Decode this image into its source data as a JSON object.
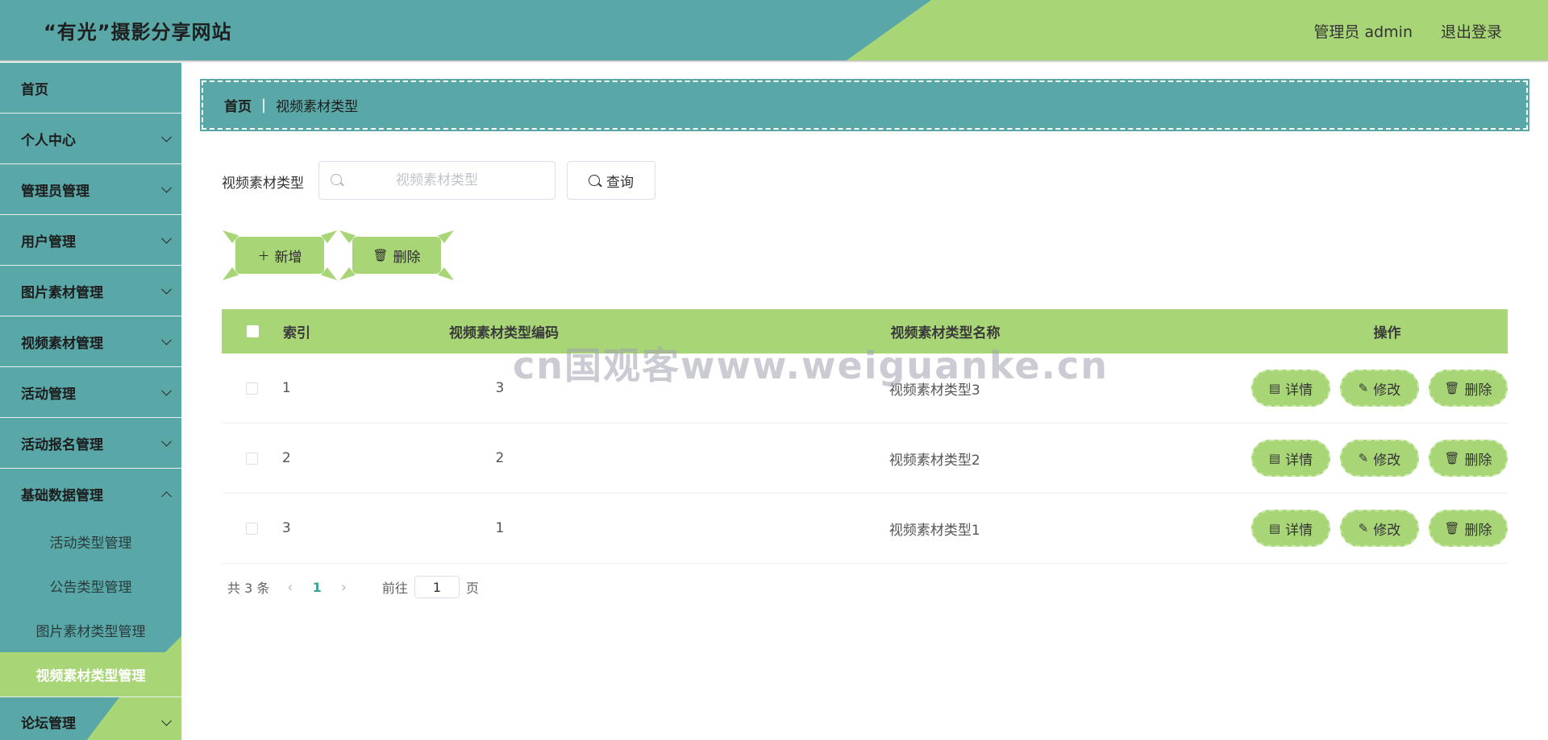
{
  "header": {
    "title": "“有光”摄影分享网站",
    "user": "管理员 admin",
    "logout": "退出登录"
  },
  "sidebar": {
    "items": [
      {
        "label": "首页"
      },
      {
        "label": "个人中心"
      },
      {
        "label": "管理员管理"
      },
      {
        "label": "用户管理"
      },
      {
        "label": "图片素材管理"
      },
      {
        "label": "视频素材管理"
      },
      {
        "label": "活动管理"
      },
      {
        "label": "活动报名管理"
      },
      {
        "label": "基础数据管理"
      }
    ],
    "subitems": [
      {
        "label": "活动类型管理"
      },
      {
        "label": "公告类型管理"
      },
      {
        "label": "图片素材类型管理"
      },
      {
        "label": "视频素材类型管理"
      }
    ],
    "last": {
      "label": "论坛管理"
    }
  },
  "breadcrumb": {
    "home": "首页",
    "separator": "|",
    "current": "视频素材类型"
  },
  "search": {
    "label": "视频素材类型",
    "placeholder": "视频素材类型",
    "value": "",
    "button": "查询"
  },
  "actions": {
    "add": "新增",
    "delete": "删除"
  },
  "table": {
    "headers": {
      "index": "索引",
      "code": "视频素材类型编码",
      "name": "视频素材类型名称",
      "ops": "操作"
    },
    "rows": [
      {
        "index": "1",
        "code": "3",
        "name": "视频素材类型3"
      },
      {
        "index": "2",
        "code": "2",
        "name": "视频素材类型2"
      },
      {
        "index": "3",
        "code": "1",
        "name": "视频素材类型1"
      }
    ],
    "ops": {
      "detail": "详情",
      "edit": "修改",
      "delete": "删除"
    }
  },
  "pagination": {
    "total": "共 3 条",
    "current": "1",
    "goto_prefix": "前往",
    "goto_value": "1",
    "goto_suffix": "页"
  },
  "watermark": "cn国观客www.weiguanke.cn",
  "colors": {
    "teal": "#5aa7a8",
    "green": "#a8d677"
  }
}
